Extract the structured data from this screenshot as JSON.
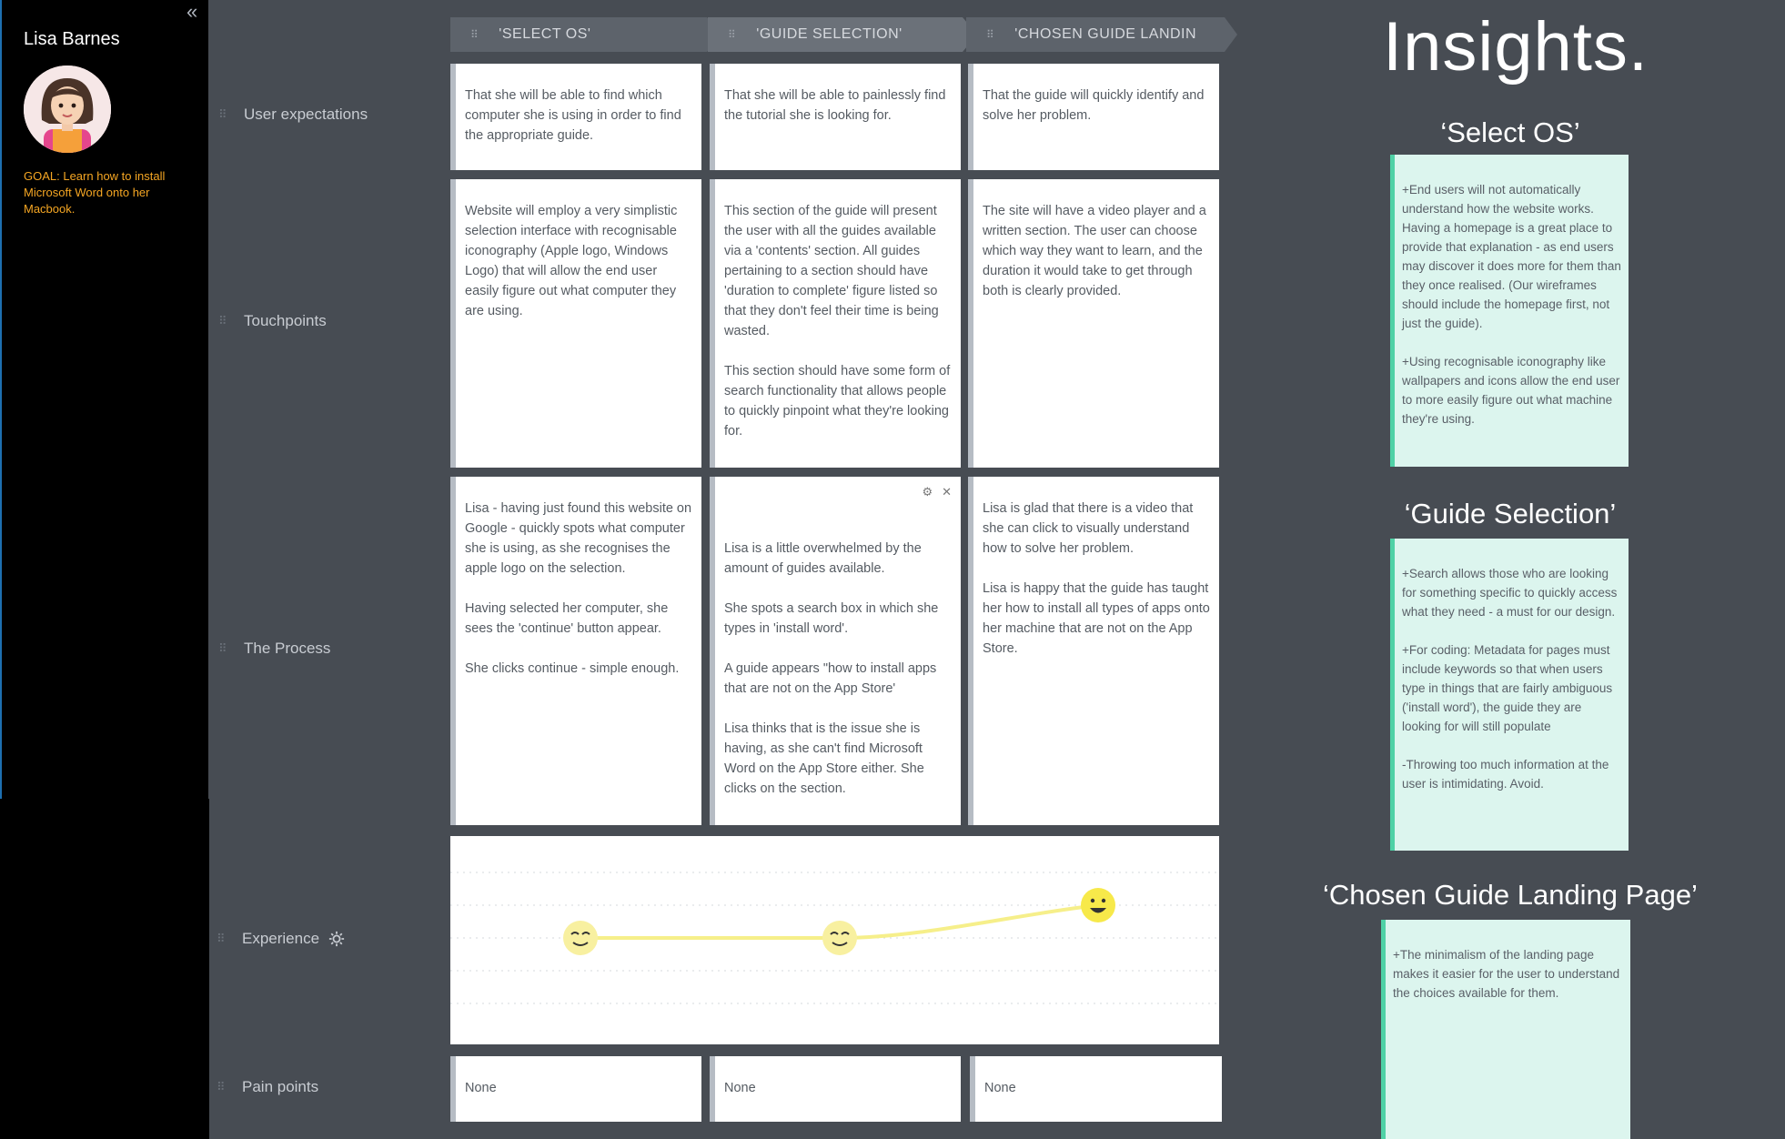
{
  "persona": {
    "name": "Lisa Barnes",
    "goal": "GOAL: Learn how to install Microsoft Word onto her Macbook.",
    "collapse_icon": "double-chevron-left-icon"
  },
  "columns": [
    {
      "title": "'SELECT OS'"
    },
    {
      "title": "'GUIDE SELECTION'"
    },
    {
      "title": "'CHOSEN GUIDE LANDIN"
    }
  ],
  "rows": {
    "user_expectations": {
      "label": "User expectations",
      "cells": [
        "That she will be able to find which computer she is using in order to find the appropriate guide.",
        "That she will be able to painlessly find the tutorial she is looking for.",
        "That the guide will quickly identify and solve her problem."
      ]
    },
    "touchpoints": {
      "label": "Touchpoints",
      "cells": [
        "Website will employ a very simplistic selection interface with recognisable iconography (Apple logo, Windows Logo) that will allow the end user easily figure out what computer they are using.",
        "This section of the guide will present the user with all the guides available via a 'contents' section. All guides pertaining to a section should have 'duration to complete' figure listed so that they don't feel their time is being wasted.\n\nThis section should have some form of search functionality that allows people to quickly pinpoint what they're looking for.",
        "The site will have a video player and a written section. The user can choose which way they want to learn, and the duration it would take to get through both is clearly provided."
      ]
    },
    "process": {
      "label": "The Process",
      "cells": [
        "Lisa - having just found this website on Google - quickly spots what computer she is using, as she recognises the apple logo on the selection.\n\nHaving selected her computer, she sees the 'continue' button appear.\n\nShe clicks continue - simple enough.",
        "Lisa is a little overwhelmed by the amount of guides available.\n\nShe spots a search box in which she types in 'install word'.\n\nA guide appears \"how to install apps that are not on the App Store'\n\nLisa thinks that is the issue she is having, as she can't find Microsoft Word on the App Store either. She clicks on the section.",
        "Lisa is glad that there is a video that she can click to visually understand how to solve her problem.\n\nLisa is happy that the guide has taught her how to install all types of apps onto her machine that are not on the App Store."
      ]
    },
    "experience": {
      "label": "Experience",
      "settings_icon": "gear-icon",
      "levels": [
        {
          "column": "'SELECT OS'",
          "mood": "content",
          "level": 3
        },
        {
          "column": "'GUIDE SELECTION'",
          "mood": "content",
          "level": 3
        },
        {
          "column": "'CHOSEN GUIDE LANDIN",
          "mood": "happy",
          "level": 4
        }
      ],
      "line_color": "#f6ef8a",
      "face_color": "#f7e94a"
    },
    "pain_points": {
      "label": "Pain points",
      "cells": [
        "None",
        "None",
        "None"
      ]
    }
  },
  "insights": {
    "title": "Insights.",
    "sections": [
      {
        "heading": "‘Select OS’",
        "text": "+End users will not automatically understand how the website works. Having a homepage is a great place to provide that explanation - as end users may discover it does more for them than they once realised. (Our wireframes should include the homepage first, not just the guide).\n\n+Using recognisable iconography like wallpapers and icons allow the end user to more easily figure out what machine they're using."
      },
      {
        "heading": "‘Guide Selection’",
        "text": "+Search allows those who are looking for something specific to quickly access what they need - a must for our design.\n\n+For coding: Metadata for pages must include keywords so that when users type in things that are fairly ambiguous ('install word'), the guide they are looking for will still populate\n\n-Throwing too much information at the user is intimidating. Avoid."
      },
      {
        "heading": "‘Chosen Guide Landing Page’",
        "text": "+The minimalism of the landing page makes it easier for the user to understand the choices available for them."
      }
    ],
    "card_color": "#dcf5ee",
    "accent_color": "#4fd1a6"
  },
  "icons": {
    "drag_handle": "drag-handle-icon",
    "card_settings": "gear-icon",
    "card_close": "close-icon"
  }
}
